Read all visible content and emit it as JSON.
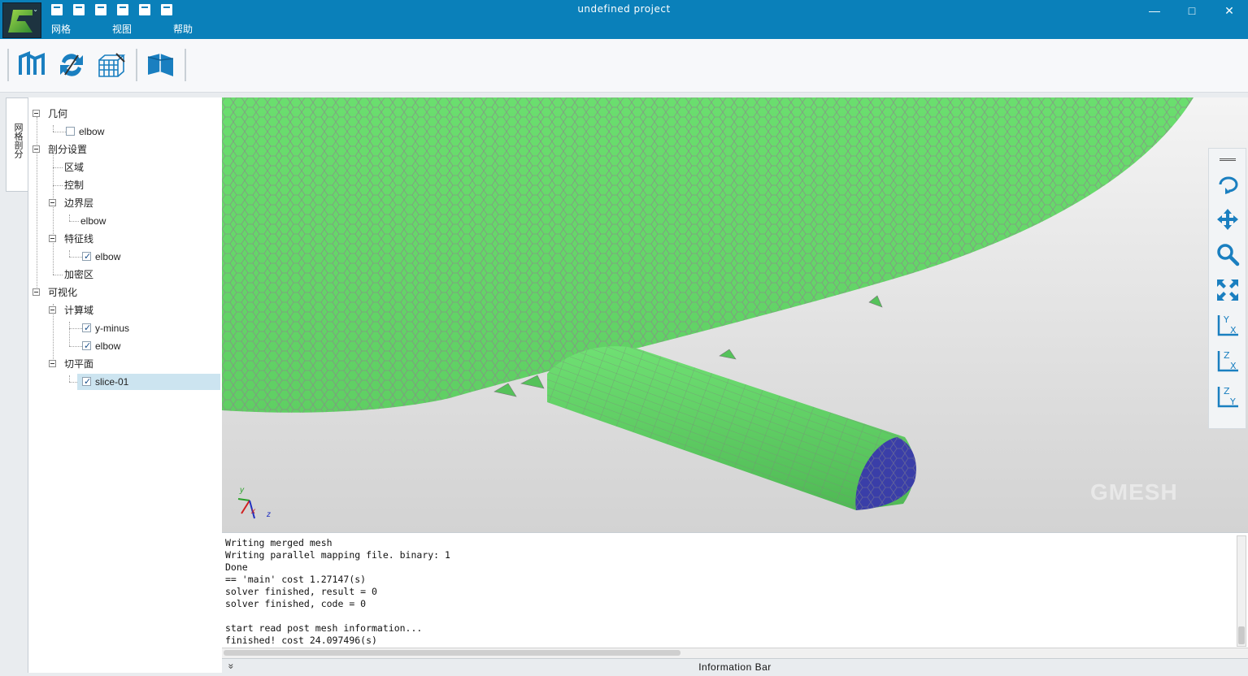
{
  "window": {
    "title": "undefined project",
    "minimize": "—",
    "maximize": "□",
    "close": "✕"
  },
  "menu": {
    "items": [
      "网格",
      "视图",
      "帮助"
    ]
  },
  "quick_access": [
    "new-file-icon",
    "edit-file-icon",
    "import-icon",
    "export-icon",
    "save-icon",
    "save-as-icon"
  ],
  "toolbar": {
    "buttons": [
      "geometry-icon",
      "swap-icon",
      "mesh-grid-icon",
      "box-icon"
    ]
  },
  "side_tab": {
    "label": "网格剖分"
  },
  "tree": {
    "geometry": "几何",
    "geometry_elbow": "elbow",
    "mesh_settings": "剖分设置",
    "region": "区域",
    "control": "控制",
    "boundary_layer": "边界层",
    "boundary_layer_elbow": "elbow",
    "feature_line": "特征线",
    "feature_line_elbow": "elbow",
    "refinement": "加密区",
    "visualization": "可视化",
    "compute_domain": "计算域",
    "y_minus": "y-minus",
    "domain_elbow": "elbow",
    "slice_plane": "切平面",
    "slice_01": "slice-01"
  },
  "view_tools": [
    "rotate-icon",
    "pan-icon",
    "zoom-icon",
    "fit-view-icon",
    "view-yx-icon",
    "view-zx-icon",
    "view-zy-icon"
  ],
  "axis_triad": {
    "y": "y",
    "x": "x",
    "z": "z"
  },
  "watermark": "GMESH",
  "console": {
    "lines": [
      "Writing merged mesh",
      "Writing parallel mapping file. binary: 1",
      "Done",
      "== 'main' cost 1.27147(s)",
      "solver finished, result = 0",
      "solver finished, code = 0",
      "",
      "start read post mesh information...",
      "finished! cost 24.097496(s)"
    ]
  },
  "info_bar": {
    "label": "Information Bar",
    "chevron": "»"
  },
  "colors": {
    "title_bar": "#0a80ba",
    "mesh_green": "#6ad86e",
    "mesh_face_blue": "#3a3ea8",
    "selection": "#cce4f0"
  }
}
